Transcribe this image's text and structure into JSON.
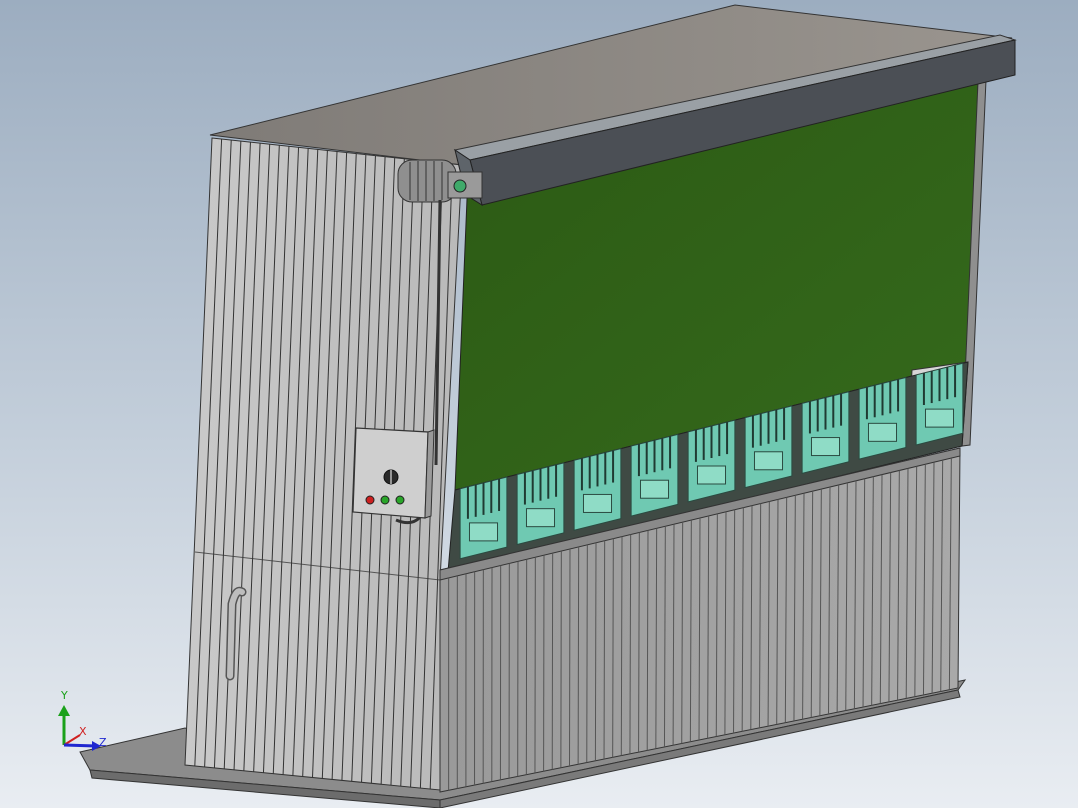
{
  "triad": {
    "x_label": "X",
    "y_label": "Y",
    "z_label": "Z"
  },
  "colors": {
    "background_top": "#9cadc0",
    "background_bottom": "#e9edf2",
    "housing": "#c8c8c8",
    "roof": "#8a8682",
    "canopy": "#4b4f55",
    "filter_screen": "#2f5e17",
    "cartridge": "#6fc9b2",
    "axis_x": "#d02020",
    "axis_y": "#1aa11a",
    "axis_z": "#2028d0"
  },
  "control_box": {
    "indicators": [
      {
        "name": "stop",
        "color": "#cc2020"
      },
      {
        "name": "run",
        "color": "#2aa52a"
      },
      {
        "name": "power",
        "color": "#2aa52a"
      }
    ]
  },
  "icons": [
    "knob-icon",
    "fan-motor-icon",
    "drain-pipe-icon"
  ]
}
